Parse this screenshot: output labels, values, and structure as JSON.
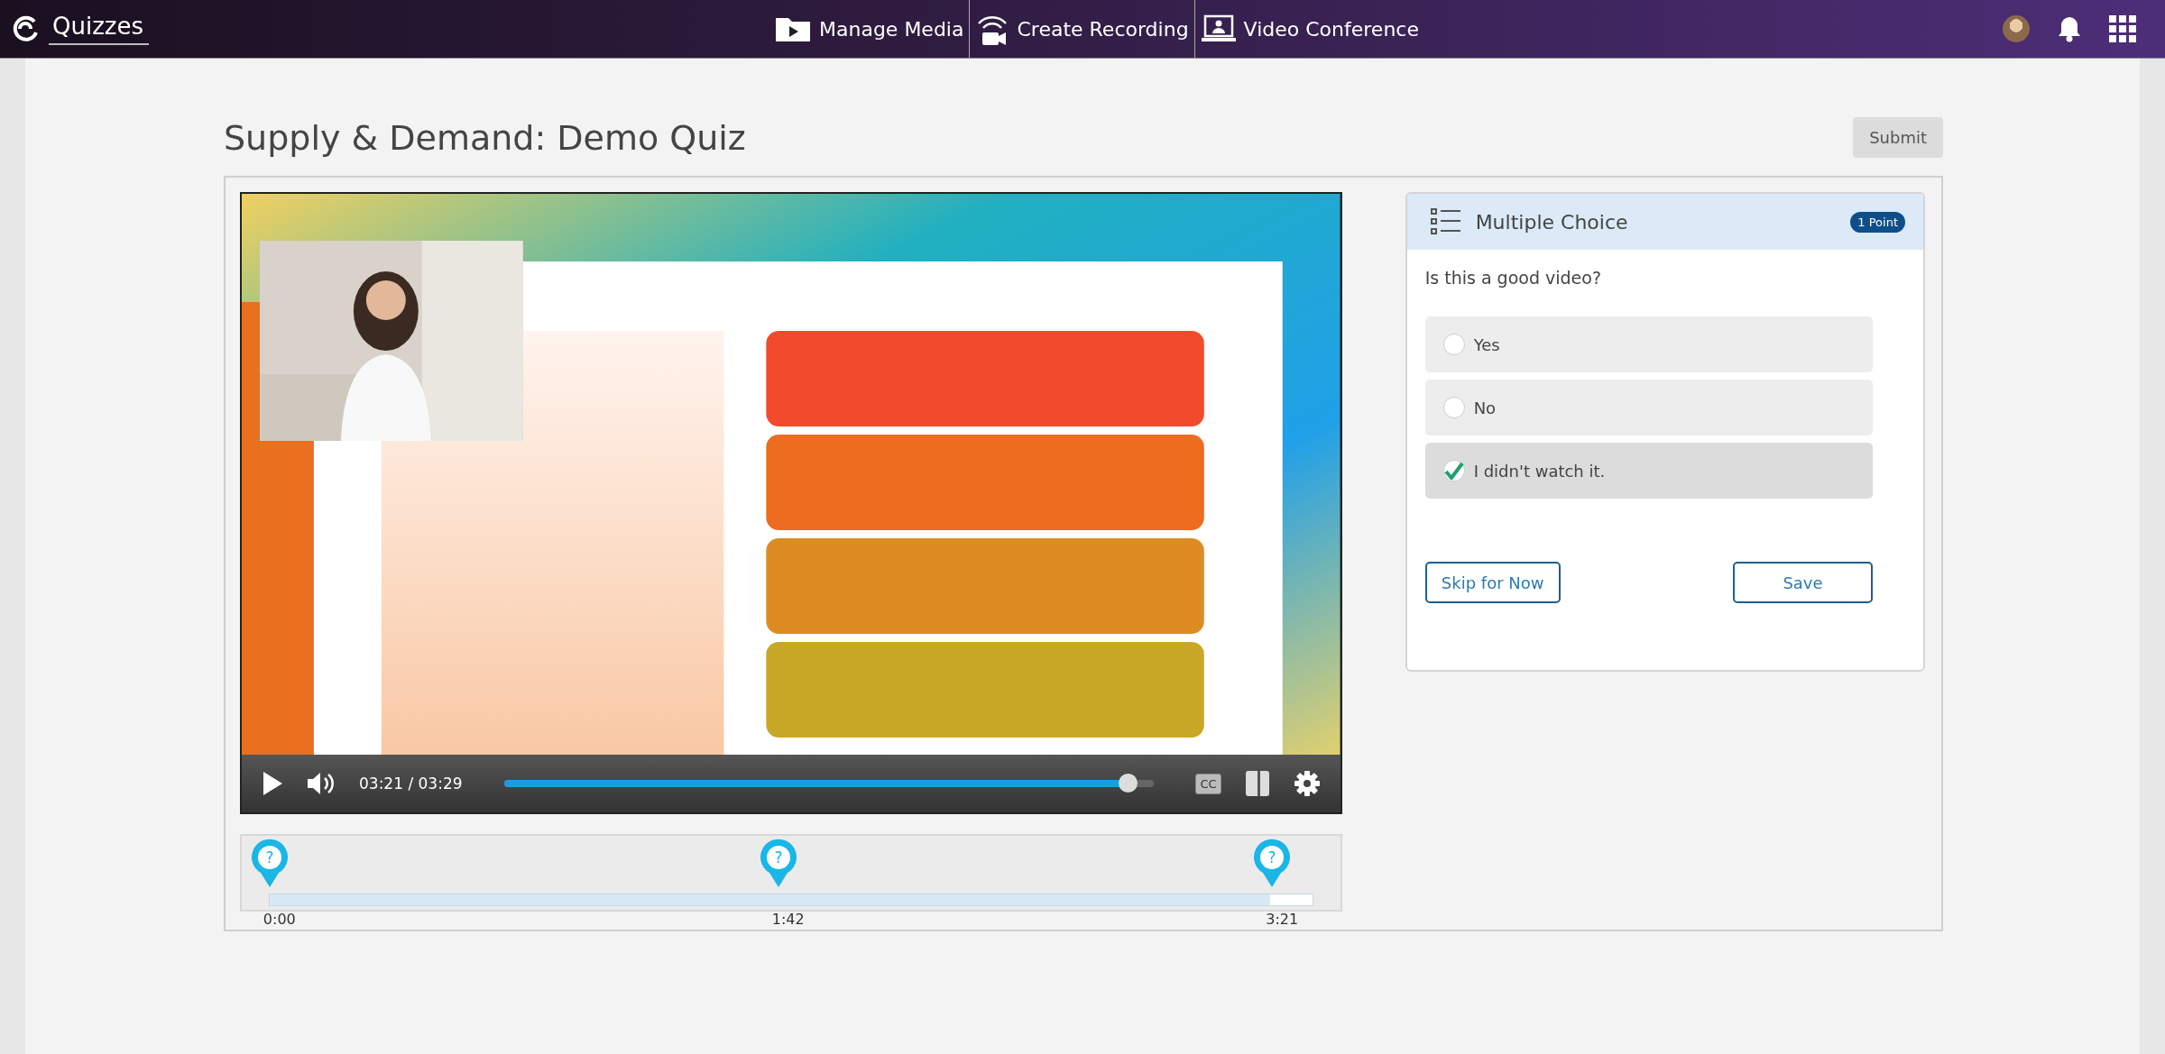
{
  "topbar": {
    "logo": "Quizzes",
    "nav": [
      {
        "label": "Manage Media",
        "kind": "media"
      },
      {
        "label": "Create Recording",
        "kind": "recording"
      },
      {
        "label": "Video Conference",
        "kind": "conference"
      }
    ]
  },
  "page": {
    "title": "Supply & Demand: Demo Quiz",
    "submit": "Submit"
  },
  "player": {
    "time": "03:21 / 03:29",
    "progress": {
      "level": 0.96
    },
    "captions": "CC"
  },
  "timeline": {
    "level": 0.96,
    "markers": [
      {
        "time": "0:00",
        "icon": "?"
      },
      {
        "time": "1:42",
        "icon": "?"
      },
      {
        "time": "3:21",
        "icon": "?"
      }
    ]
  },
  "question": {
    "type": "Multiple Choice",
    "points": "1 Point",
    "text": "Is this a good video?",
    "options": [
      {
        "label": "Yes",
        "selected": false
      },
      {
        "label": "No",
        "selected": false
      },
      {
        "label": "I didn't watch it.",
        "selected": true
      }
    ],
    "buttons": [
      {
        "label": "Skip for Now",
        "kind": "skip"
      },
      {
        "label": "Save",
        "kind": "save"
      }
    ]
  }
}
